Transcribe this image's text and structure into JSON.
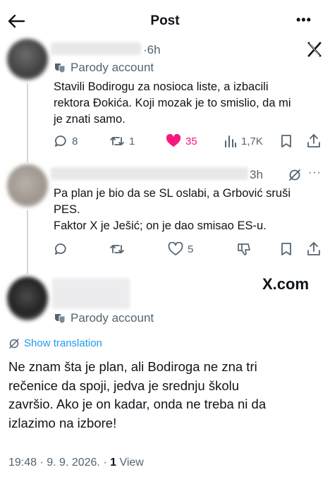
{
  "header": {
    "title": "Post",
    "more": "•••"
  },
  "tweet1": {
    "time": "·6h",
    "label": "Parody account",
    "text_lines": [
      "Stavili Bodirogu za nosioca liste, a izbacili",
      "rektora Đokića. Koji mozak je to smislio, da mi",
      "je znati samo."
    ],
    "stats": {
      "replies": "8",
      "reposts": "1",
      "likes": "35",
      "views": "1,7K"
    },
    "colors": {
      "like": "#f91880"
    }
  },
  "tweet2": {
    "time": "3h",
    "text_lines": [
      "Pa plan je bio da se SL oslabi, a Grbović sruši",
      "PES.",
      "Faktor X je Ješić; on je dao smisao ES-u."
    ],
    "stats": {
      "likes": "5"
    }
  },
  "main": {
    "watermark": "X.com",
    "label": "Parody account",
    "show_translation": "Show translation",
    "text_lines": [
      "Ne znam šta je plan, ali Bodiroga ne zna tri",
      "rečenice da spoji, jedva je srednju školu",
      "završio. Ako je on kadar, onda ne treba ni da",
      "izlazimo na izbore!"
    ],
    "meta_prefix": "19:48 · 9. 9. 2026. · ",
    "views_count": "1",
    "views_label": " View",
    "colors": {
      "link": "#1d9bf0"
    }
  }
}
